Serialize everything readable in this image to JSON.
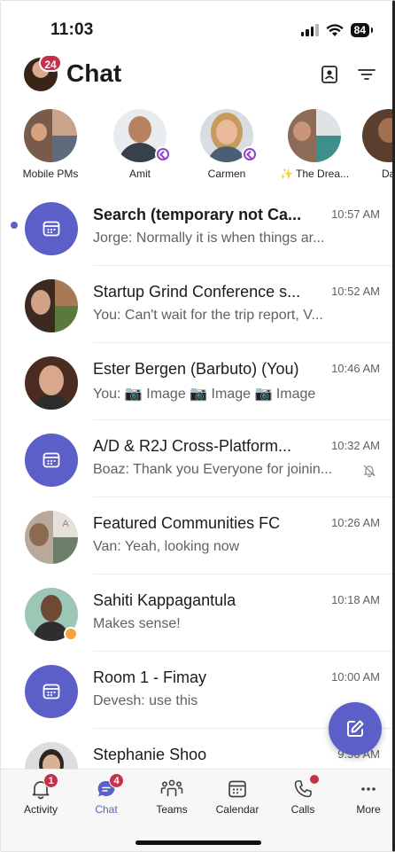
{
  "status_bar": {
    "time": "11:03",
    "battery": "84"
  },
  "header": {
    "title": "Chat",
    "badge": "24"
  },
  "stories": [
    {
      "name": "Mobile PMs"
    },
    {
      "name": "Amit"
    },
    {
      "name": "Carmen"
    },
    {
      "name": "✨ The Drea..."
    },
    {
      "name": "Da"
    }
  ],
  "chats": [
    {
      "title": "Search (temporary not Ca...",
      "time": "10:57 AM",
      "preview": "Jorge: Normally it is when things ar...",
      "unread": true
    },
    {
      "title": "Startup Grind Conference s...",
      "time": "10:52 AM",
      "preview": "You: Can't wait for the trip report, V..."
    },
    {
      "title": "Ester Bergen (Barbuto) (You)",
      "time": "10:46 AM",
      "preview": "You: 📷 Image 📷 Image 📷 Image"
    },
    {
      "title": "A/D & R2J Cross-Platform...",
      "time": "10:32 AM",
      "preview": "Boaz: Thank you Everyone for joinin..."
    },
    {
      "title": "Featured Communities FC",
      "time": "10:26 AM",
      "preview": "Van: Yeah, looking now"
    },
    {
      "title": "Sahiti Kappagantula",
      "time": "10:18 AM",
      "preview": "Makes sense!"
    },
    {
      "title": "Room 1 - Fimay",
      "time": "10:00 AM",
      "preview": "Devesh: use this"
    },
    {
      "title": "Stephanie Shoo",
      "time": "9:50 AM",
      "preview": ""
    }
  ],
  "tabs": [
    {
      "label": "Activity",
      "badge": "1"
    },
    {
      "label": "Chat",
      "badge": "4"
    },
    {
      "label": "Teams"
    },
    {
      "label": "Calendar"
    },
    {
      "label": "Calls"
    },
    {
      "label": "More"
    }
  ],
  "colors": {
    "accent": "#5b5fc7",
    "badge": "#c4314b"
  }
}
